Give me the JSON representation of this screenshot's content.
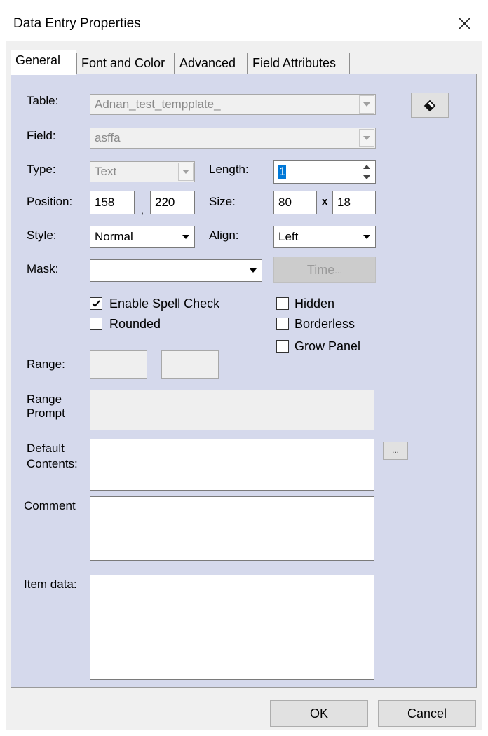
{
  "window": {
    "title": "Data Entry Properties"
  },
  "tabs": [
    {
      "label": "General",
      "active": true
    },
    {
      "label": "Font and Color",
      "active": false
    },
    {
      "label": "Advanced",
      "active": false
    },
    {
      "label": "Field Attributes",
      "active": false
    }
  ],
  "general": {
    "table": {
      "label": "Table:",
      "value": "Adnan_test_tempplate_"
    },
    "field": {
      "label": "Field:",
      "value": "asffa"
    },
    "type": {
      "label": "Type:",
      "value": "Text"
    },
    "length": {
      "label": "Length:",
      "value": "1"
    },
    "position": {
      "label": "Position:",
      "x": "158",
      "separator": ",",
      "y": "220"
    },
    "size": {
      "label": "Size:",
      "width": "80",
      "separator": "x",
      "height": "18"
    },
    "style": {
      "label": "Style:",
      "value": "Normal"
    },
    "align": {
      "label": "Align:",
      "value": "Left"
    },
    "mask": {
      "label": "Mask:",
      "value": ""
    },
    "time_button": {
      "label_pre": "Tim",
      "label_mnemonic": "e",
      "label_post": " ..."
    },
    "checkboxes": {
      "enable_spell_check": {
        "label": "Enable Spell Check",
        "checked": true
      },
      "rounded": {
        "label": "Rounded",
        "checked": false
      },
      "hidden": {
        "label": "Hidden",
        "checked": false
      },
      "borderless": {
        "label": "Borderless",
        "checked": false
      },
      "grow_panel": {
        "label": "Grow Panel",
        "checked": false
      }
    },
    "range": {
      "label": "Range:",
      "min": "",
      "max": ""
    },
    "range_prompt": {
      "label_line1": "Range",
      "label_line2": "Prompt",
      "value": ""
    },
    "default_contents": {
      "label_line1": "Default",
      "label_line2": "Contents:",
      "value": "",
      "browse_label": "..."
    },
    "comment": {
      "label": "Comment",
      "value": ""
    },
    "item_data": {
      "label": "Item data:",
      "value": ""
    }
  },
  "footer": {
    "ok_label": "OK",
    "cancel_label": "Cancel"
  },
  "icons": {
    "close": "close-icon",
    "picker": "eraser-icon",
    "dropdown": "chevron-down-icon",
    "check": "checkmark-icon"
  },
  "colors": {
    "panel_bg": "#d5d9ec",
    "selection": "#0078d7",
    "dialog_bg": "#f0f0f0"
  }
}
